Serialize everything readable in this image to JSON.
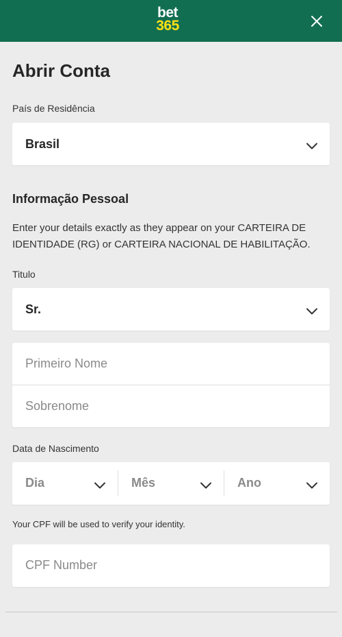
{
  "header": {
    "logo_line1": "bet",
    "logo_line2": "365",
    "brand_color": "#126e51",
    "logo_accent": "#ffe115"
  },
  "page_title": "Abrir Conta",
  "country": {
    "label": "País de Residência",
    "value": "Brasil"
  },
  "personal": {
    "section_title": "Informação Pessoal",
    "description": "Enter your details exactly as they appear on your CARTEIRA DE IDENTIDADE (RG) or CARTEIRA NACIONAL DE HABILITAÇÃO.",
    "title_label": "Titulo",
    "title_value": "Sr.",
    "first_name_placeholder": "Primeiro Nome",
    "last_name_placeholder": "Sobrenome"
  },
  "dob": {
    "label": "Data de Nascimento",
    "day": "Dia",
    "month": "Mês",
    "year": "Ano"
  },
  "cpf": {
    "note": "Your CPF will be used to verify your identity.",
    "placeholder": "CPF Number"
  }
}
